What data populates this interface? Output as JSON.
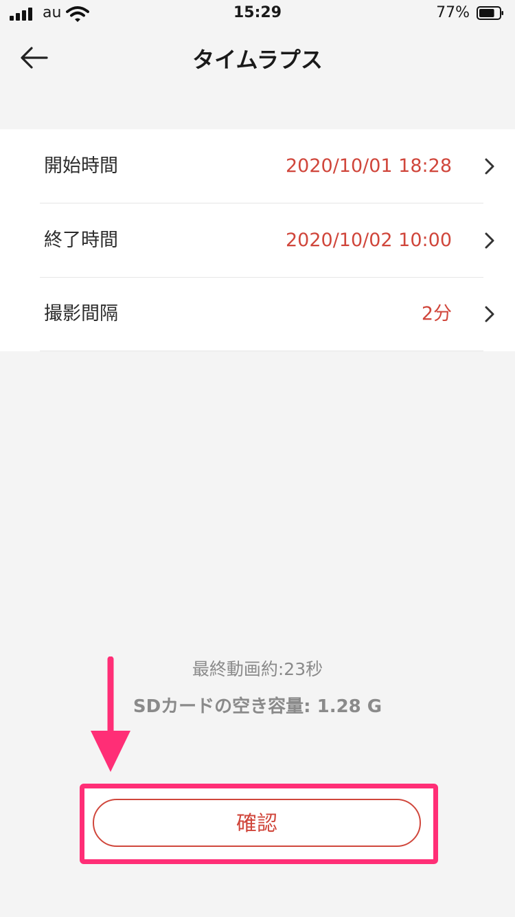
{
  "status_bar": {
    "carrier": "au",
    "time": "15:29",
    "battery_percent": "77%",
    "battery_level": 0.77,
    "icons": [
      "signal-icon",
      "wifi-icon",
      "battery-icon"
    ]
  },
  "nav": {
    "title": "タイムラプス",
    "back_icon": "back-arrow-icon"
  },
  "settings": [
    {
      "label": "開始時間",
      "value": "2020/10/01  18:28"
    },
    {
      "label": "終了時間",
      "value": "2020/10/02  10:00"
    },
    {
      "label": "撮影間隔",
      "value": "2分"
    }
  ],
  "info": {
    "final_video": "最終動画約:23秒",
    "sd_free": "SDカードの空き容量: 1.28 G"
  },
  "confirm_label": "確認",
  "colors": {
    "accent": "#d0463b",
    "annotation": "#ff2e76",
    "background": "#f4f4f4"
  }
}
